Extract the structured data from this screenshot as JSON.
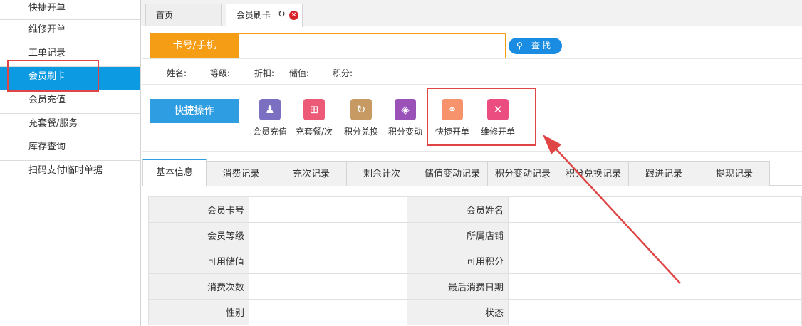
{
  "sidebar": {
    "items": [
      "快捷开单",
      "维修开单",
      "工单记录",
      "会员刷卡",
      "会员充值",
      "充套餐/服务",
      "库存查询",
      "扫码支付临时单据"
    ],
    "active_index": 3
  },
  "tabs": {
    "home": "首页",
    "member_card": "会员刷卡",
    "refresh_icon": "↻",
    "close_icon": "×"
  },
  "search": {
    "label": "卡号/手机",
    "value": "",
    "button_label": "查找",
    "search_icon": "⚲"
  },
  "info": {
    "name": "姓名:",
    "level": "等级:",
    "discount": "折扣:",
    "balance": "储值:",
    "points": "积分:"
  },
  "quick": {
    "label": "快捷操作",
    "actions": [
      {
        "label": "会员充值",
        "icon": "member-recharge-icon",
        "color": "#7b6fc2"
      },
      {
        "label": "充套餐/次",
        "icon": "package-icon",
        "color": "#ec5a78"
      },
      {
        "label": "积分兑换",
        "icon": "exchange-icon",
        "color": "#c79a63"
      },
      {
        "label": "积分变动",
        "icon": "tag-icon",
        "color": "#9a52b8"
      },
      {
        "label": "快捷开单",
        "icon": "quick-order-icon",
        "color": "#f6936d"
      },
      {
        "label": "维修开单",
        "icon": "repair-icon",
        "color": "#ec4d80"
      }
    ]
  },
  "detail_tabs": [
    "基本信息",
    "消费记录",
    "充次记录",
    "剩余计次",
    "储值变动记录",
    "积分变动记录",
    "积分兑换记录",
    "跟进记录",
    "提现记录"
  ],
  "table": {
    "rows": [
      [
        "会员卡号",
        "会员姓名"
      ],
      [
        "会员等级",
        "所属店铺"
      ],
      [
        "可用储值",
        "可用积分"
      ],
      [
        "消费次数",
        "最后消费日期"
      ],
      [
        "性别",
        "状态"
      ]
    ]
  },
  "colors": {
    "accent_blue": "#0c9be3",
    "search_orange": "#f59e15",
    "highlight_red": "#e04545"
  }
}
